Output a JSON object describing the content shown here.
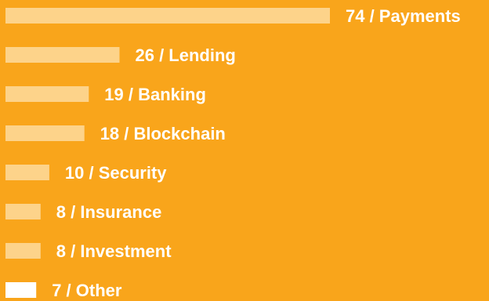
{
  "colors": {
    "background": "#f9a51b",
    "bar": "#fdd38a",
    "bar_other": "#ffffff",
    "text": "#ffffff"
  },
  "chart_data": {
    "type": "bar",
    "orientation": "horizontal",
    "categories": [
      "Payments",
      "Lending",
      "Banking",
      "Blockchain",
      "Security",
      "Insurance",
      "Investment",
      "Other"
    ],
    "values": [
      74,
      26,
      19,
      18,
      10,
      8,
      8,
      7
    ],
    "labels": [
      "74 / Payments",
      "26 / Lending",
      "19 / Banking",
      "18 / Blockchain",
      "10 / Security",
      "8 / Insurance",
      "8 / Investment",
      "7 / Other"
    ],
    "title": "",
    "xlabel": "",
    "ylabel": "",
    "grid": false,
    "legend": "none"
  }
}
